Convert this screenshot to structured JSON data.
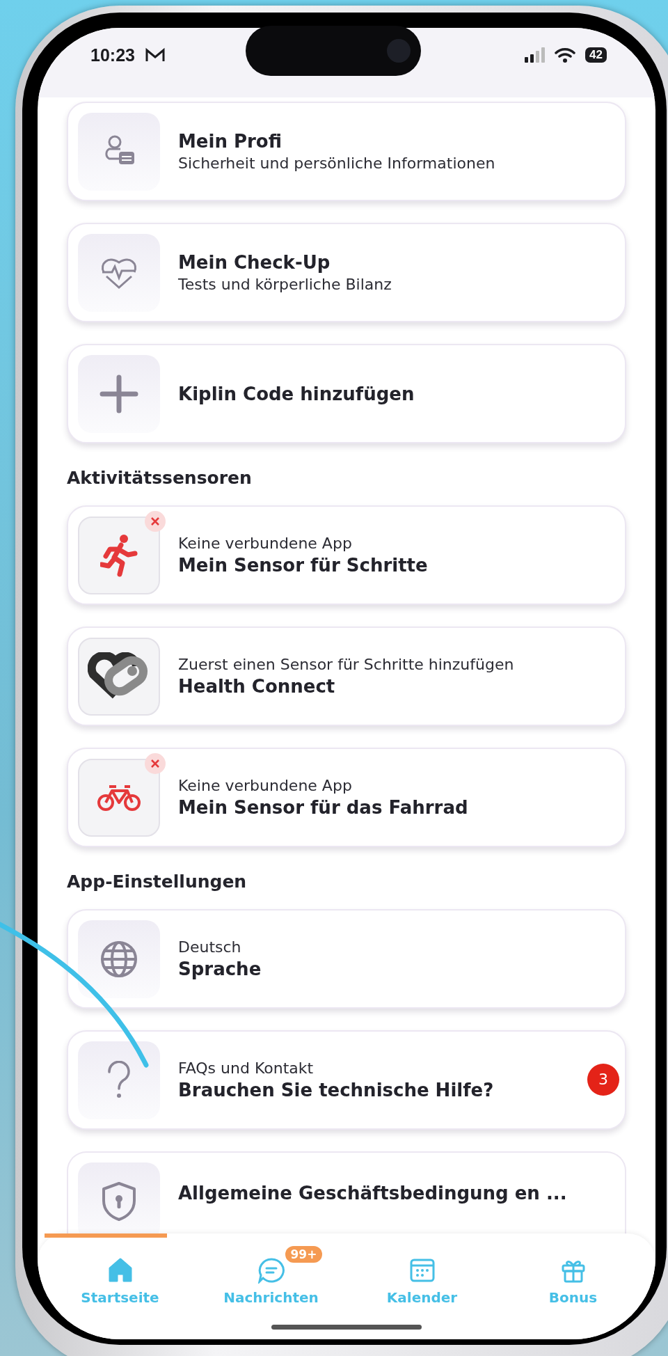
{
  "status_bar": {
    "time": "10:23",
    "battery": "42"
  },
  "sections": [
    {
      "cards": [
        {
          "lines": [
            {
              "kind": "title",
              "text": "Mein Profi"
            },
            {
              "kind": "caption",
              "text": "Sicherheit und persönliche Informationen"
            }
          ]
        },
        {
          "lines": [
            {
              "kind": "title",
              "text": "Mein Check-Up"
            },
            {
              "kind": "caption",
              "text": "Tests und körperliche Bilanz"
            }
          ]
        },
        {
          "lines": [
            {
              "kind": "title",
              "text": "Kiplin Code hinzufügen"
            }
          ]
        }
      ]
    },
    {
      "heading": "Aktivitätssensoren",
      "cards": [
        {
          "connected": false,
          "lines": [
            {
              "kind": "caption",
              "text": "Keine verbundene App"
            },
            {
              "kind": "title",
              "text": "Mein Sensor für Schritte"
            }
          ]
        },
        {
          "lines": [
            {
              "kind": "caption",
              "text": "Zuerst einen Sensor für Schritte hinzufügen"
            },
            {
              "kind": "title",
              "text": "Health Connect"
            }
          ]
        },
        {
          "connected": false,
          "lines": [
            {
              "kind": "caption",
              "text": "Keine verbundene App"
            },
            {
              "kind": "title",
              "text": "Mein Sensor für das Fahrrad"
            }
          ]
        }
      ]
    },
    {
      "heading": "App-Einstellungen",
      "cards": [
        {
          "lines": [
            {
              "kind": "caption",
              "text": "Deutsch"
            },
            {
              "kind": "title",
              "text": "Sprache"
            }
          ]
        },
        {
          "badge": "3",
          "lines": [
            {
              "kind": "caption",
              "text": "FAQs und Kontakt"
            },
            {
              "kind": "title",
              "text": "Brauchen Sie technische Hilfe?"
            }
          ]
        },
        {
          "lines": [
            {
              "kind": "title",
              "text": "Allgemeine Geschäftsbedingung en ..."
            }
          ]
        }
      ]
    }
  ],
  "tabs": [
    {
      "label": "Startseite",
      "selected": true
    },
    {
      "label": "Nachrichten",
      "selected": false,
      "badge": "99+"
    },
    {
      "label": "Kalender",
      "selected": false
    },
    {
      "label": "Bonus",
      "selected": false
    }
  ]
}
